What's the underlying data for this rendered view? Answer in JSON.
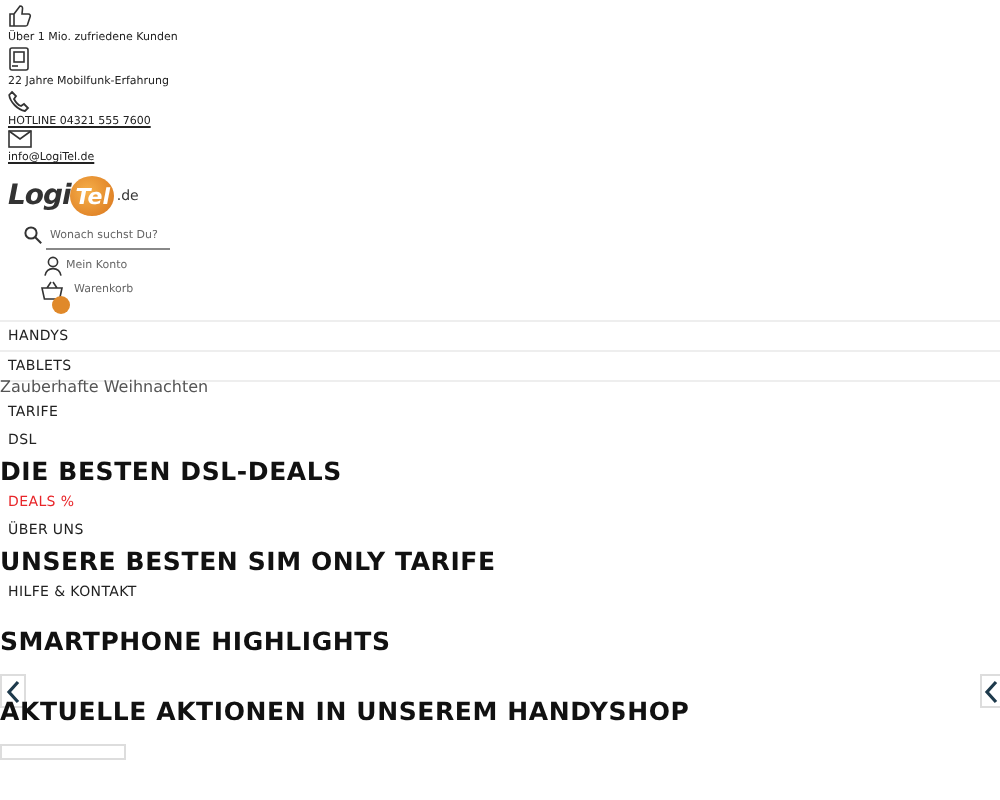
{
  "top_info": [
    {
      "kind": "thumb",
      "text": "Über 1 Mio. zufriedene Kunden",
      "link": false
    },
    {
      "kind": "card",
      "text": "22 Jahre Mobilfunk-Erfahrung",
      "link": false
    },
    {
      "kind": "phone",
      "text": "HOTLINE 04321 555 7600",
      "link": true
    },
    {
      "kind": "mail",
      "text": "info@LogiTel.de",
      "link": true
    }
  ],
  "logo": {
    "text": "Logi",
    "badge": "Tel",
    "suffix": ".de"
  },
  "search": {
    "placeholder": "Wonach suchst Du?"
  },
  "account": "Mein Konto",
  "cart": "Warenkorb",
  "menu_flow": [
    {
      "kind": "nav",
      "label": "HANDYS",
      "highlight": false
    },
    {
      "kind": "nav",
      "label": "TABLETS",
      "highlight": false
    },
    {
      "kind": "caption",
      "label": "Zauberhafte Weihnachten"
    },
    {
      "kind": "nav",
      "label": "TARIFE",
      "highlight": false
    },
    {
      "kind": "nav",
      "label": "DSL",
      "highlight": false
    },
    {
      "kind": "heading",
      "label": "DIE BESTEN DSL-DEALS"
    },
    {
      "kind": "nav",
      "label": "DEALS %",
      "highlight": true
    },
    {
      "kind": "nav",
      "label": "ÜBER UNS",
      "highlight": false
    },
    {
      "kind": "heading",
      "label": "UNSERE BESTEN SIM ONLY TARIFE"
    },
    {
      "kind": "nav",
      "label": "HILFE & KONTAKT",
      "highlight": false
    }
  ],
  "sections": [
    {
      "kind": "heading",
      "label": "SMARTPHONE HIGHLIGHTS"
    },
    {
      "kind": "arrows"
    },
    {
      "kind": "heading",
      "label": "AKTUELLE AKTIONEN IN UNSEREM HANDYSHOP"
    },
    {
      "kind": "field"
    }
  ]
}
